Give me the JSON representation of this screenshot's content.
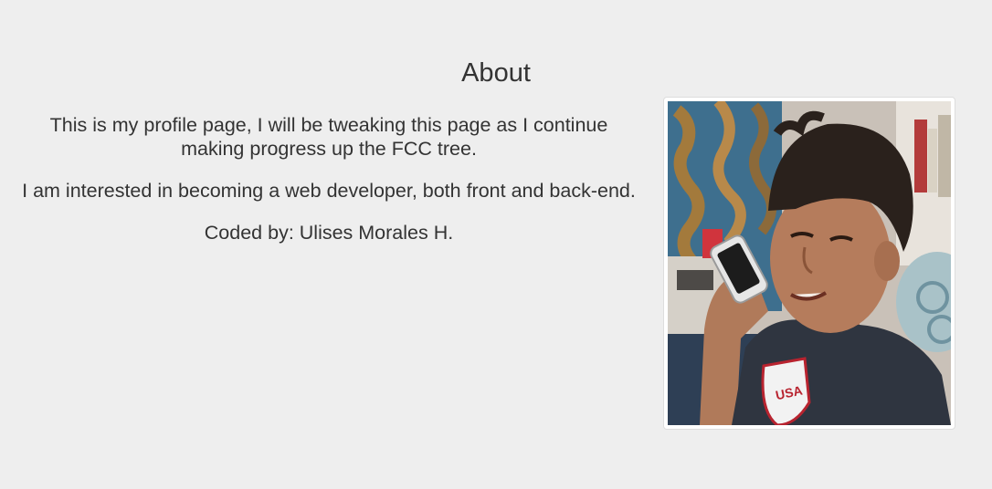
{
  "about": {
    "title": "About",
    "paragraphs": [
      "This is my profile page, I will be tweaking this page as I continue making progress up the FCC tree.",
      "I am interested in becoming a web developer, both front and back-end.",
      "Coded by: Ulises Morales H."
    ]
  },
  "photo": {
    "description_icon": "profile-photo",
    "shirt_text": "USA"
  },
  "colors": {
    "background": "#eeeeee",
    "text": "#333333",
    "frame": "#ffffff"
  }
}
